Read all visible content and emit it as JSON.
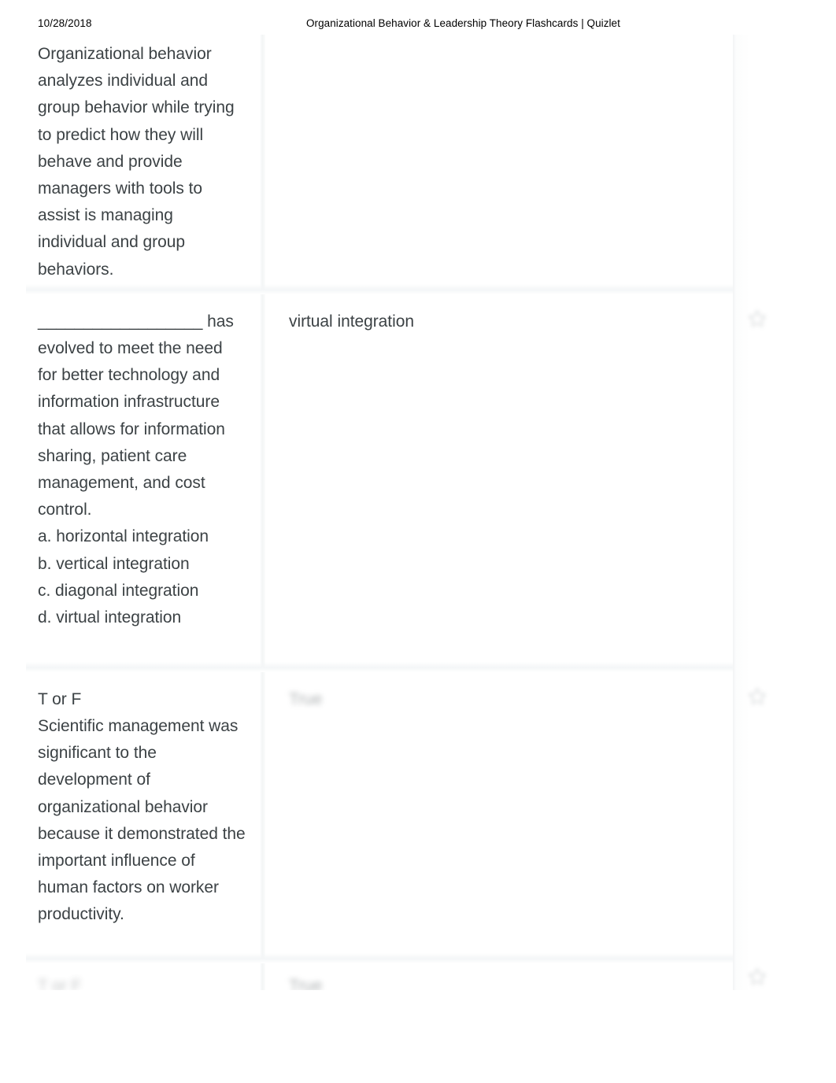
{
  "header": {
    "date": "10/28/2018",
    "title": "Organizational Behavior & Leadership Theory Flashcards | Quizlet"
  },
  "colors": {
    "text": "#3c4245",
    "header_text": "#000000",
    "divider": "#f3f5f6",
    "page_background": "#ffffff"
  },
  "icons": {
    "star": "star-icon"
  },
  "cards": [
    {
      "id": "card-1",
      "term": "Organizational behavior analyzes individual and group behavior while trying to predict how they will behave and provide managers with tools to assist is managing individual and group behaviors.",
      "definition": "",
      "definition_legible": false,
      "clipped_top": true,
      "star_visible": false
    },
    {
      "id": "card-2",
      "term": "__________________ has evolved to meet the need for better technology and information infrastructure that allows for information sharing, patient care management, and cost control.\na. horizontal integration\nb. vertical integration\nc. diagonal integration\nd. virtual integration",
      "definition": "virtual integration",
      "definition_legible": true,
      "clipped_top": false,
      "star_visible": true
    },
    {
      "id": "card-3",
      "term": "T or F\nScientific management was significant to the development of organizational behavior because it demonstrated the important influence of human factors on worker productivity.",
      "definition": "True",
      "definition_legible": false,
      "clipped_top": false,
      "star_visible": true
    },
    {
      "id": "card-4",
      "term": "T or F",
      "definition": "True",
      "definition_legible": false,
      "clipped_top": false,
      "star_visible": true,
      "partial": true
    }
  ]
}
